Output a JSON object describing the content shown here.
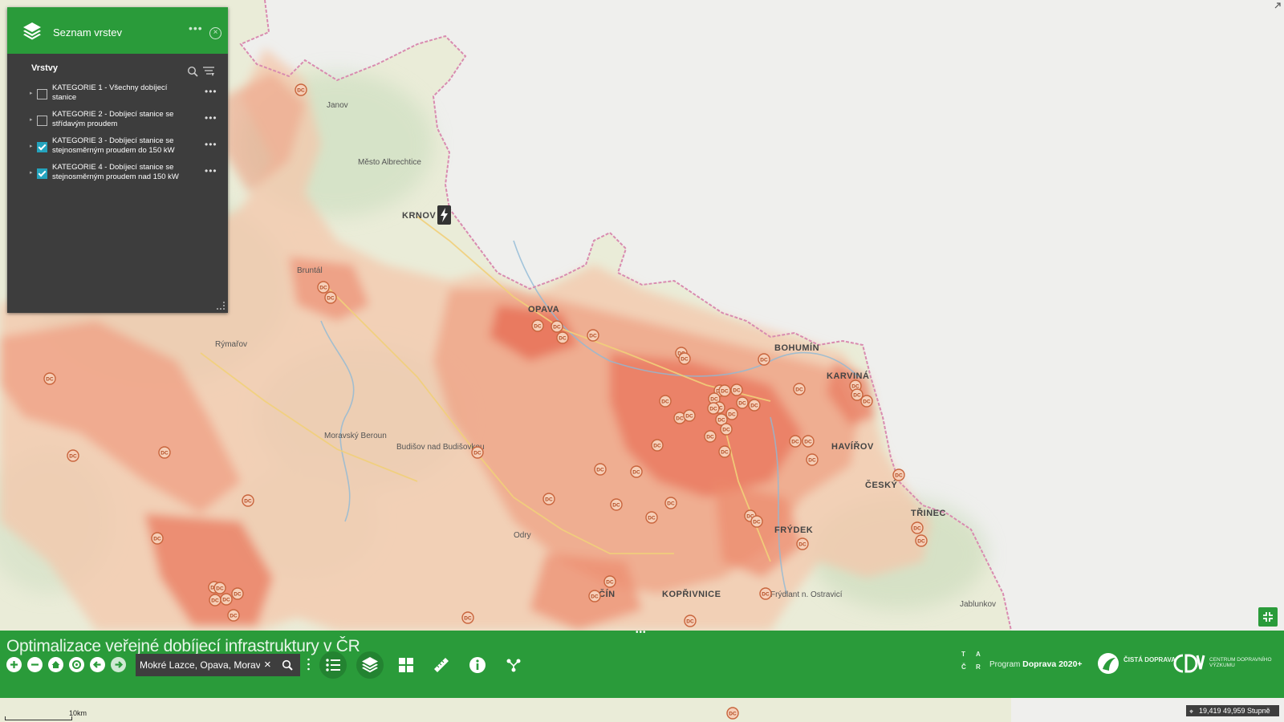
{
  "layer_panel": {
    "title": "Seznam vrstev",
    "more_label": "•••",
    "close_label": "×",
    "subheading": "Vrstvy",
    "layers": [
      {
        "label": "KATEGORIE 1 - Všechny dobíjecí stanice",
        "checked": false
      },
      {
        "label": "KATEGORIE 2 - Dobíjecí stanice se střídavým proudem",
        "checked": false
      },
      {
        "label": "KATEGORIE 3 - Dobíjecí stanice se stejnosměrným proudem do 150 kW",
        "checked": true
      },
      {
        "label": "KATEGORIE 4 - Dobíjecí stanice se stejnosměrným proudem nad 150 kW",
        "checked": true
      }
    ]
  },
  "map": {
    "marker_label": "DC",
    "towns": {
      "krnov": "KRNOV",
      "opava": "OPAVA",
      "bruntal": "Bruntál",
      "rymarov": "Rýmařov",
      "janov": "Janov",
      "mesto_albrechtice": "Město Albrechtice",
      "moravsky_beroun": "Moravský Beroun",
      "budisov": "Budišov nad Budišovkou",
      "odry": "Odry",
      "bohumin": "BOHUMÍN",
      "karvina": "KARVINÁ",
      "frydlant": "Frýdlant n. Ostravicí",
      "trinec": "TŘINEC",
      "jablunkov": "Jablunkov",
      "kopřivnice": "KOPŘIVNICE",
      "frydek": "FRÝDEK",
      "cesky_tesin": "ČESKÝ",
      "havirov": "HAVÍŘOV",
      "novy_jicin": "JIČÍN"
    }
  },
  "bottom_bar": {
    "handle": "•••",
    "title": "Optimalizace veřejné dobíjecí infrastruktury v ČR",
    "search_value": "Mokré Lazce, Opava, Morav",
    "search_clear": "×",
    "program_prefix": "Program",
    "program_name": "Doprava 2020+",
    "cista_doprava": "ČISTÁ DOPRAVA",
    "cdv_text": "CENTRUM DOPRAVNÍHO VÝZKUMU",
    "tacr_letters": [
      "T",
      "A",
      "Č",
      "R"
    ]
  },
  "status": {
    "coordinates": "19,419 49,959 Stupně",
    "scale_label": "10km"
  },
  "colors": {
    "accent_green": "#2a9b3a",
    "panel_bg": "#3d3d3d",
    "checkbox_blue": "#24a3bd",
    "heat_red": "#e8634a"
  }
}
